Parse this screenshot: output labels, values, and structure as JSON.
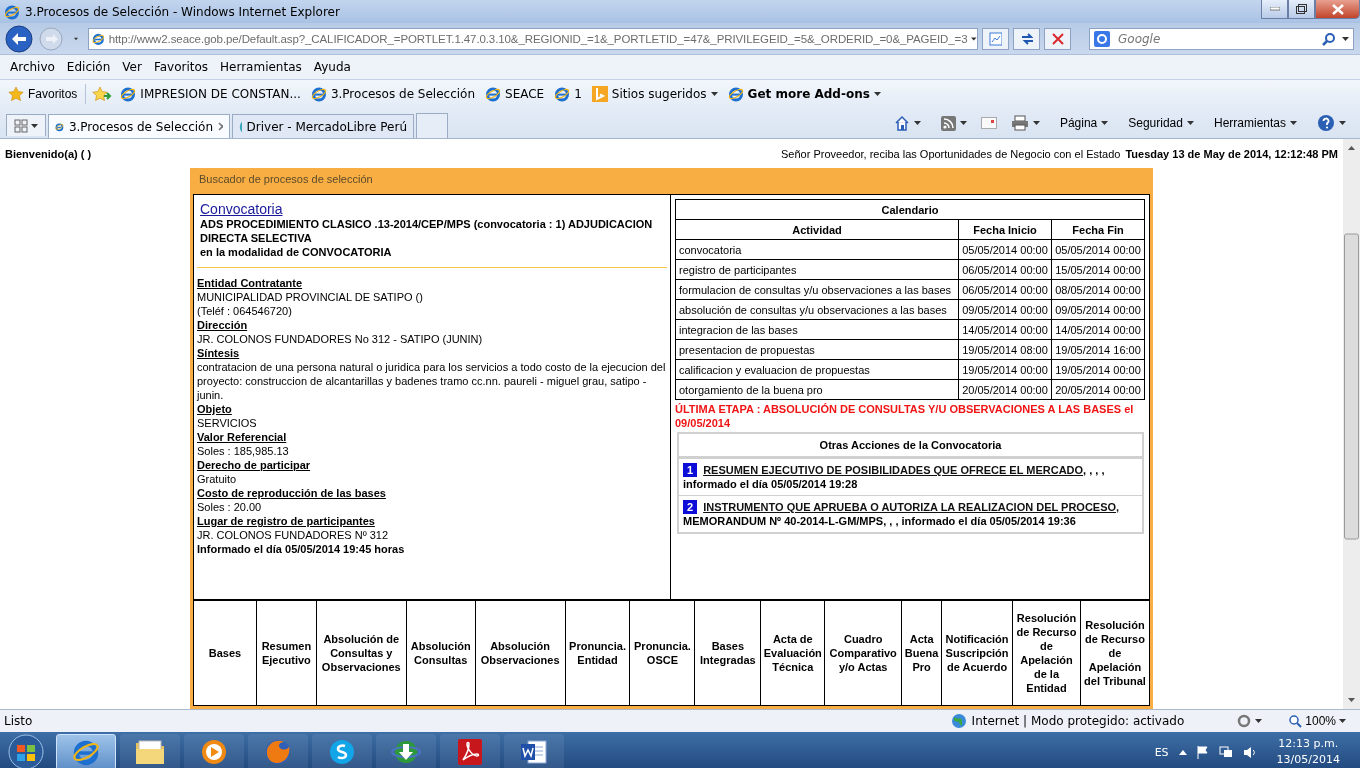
{
  "window": {
    "title": "3.Procesos de Selección - Windows Internet Explorer"
  },
  "address_bar": {
    "url": "http://www2.seace.gob.pe/Default.asp?_CALIFICADOR_=PORTLET.1.47.0.3.10&_REGIONID_=1&_PORTLETID_=47&_PRIVILEGEID_=5&_ORDERID_=0&_PAGEID_=3",
    "search_placeholder": "Google"
  },
  "menu": [
    "Archivo",
    "Edición",
    "Ver",
    "Favoritos",
    "Herramientas",
    "Ayuda"
  ],
  "favorites_bar": {
    "label": "Favoritos",
    "items": [
      {
        "label": "IMPRESION DE CONSTAN...",
        "kind": "page"
      },
      {
        "label": "3.Procesos de Selección",
        "kind": "page"
      },
      {
        "label": "SEACE",
        "kind": "page"
      },
      {
        "label": "1",
        "kind": "page"
      },
      {
        "label": "Sitios sugeridos",
        "kind": "suggested"
      },
      {
        "label": "Get more Add-ons",
        "kind": "addons"
      }
    ]
  },
  "tabs": [
    {
      "label": "3.Procesos de Selección",
      "selected": true
    },
    {
      "label": "Driver - MercadoLibre Perú",
      "selected": false
    }
  ],
  "command_bar": [
    "Página",
    "Seguridad",
    "Herramientas"
  ],
  "page": {
    "welcome": "Bienvenido(a) ( )",
    "slogan": "Señor Proveedor, reciba las Oportunidades de Negocio con el Estado",
    "date": "Tuesday 13 de May de 2014, 12:12:48 PM",
    "panel_title": "Buscador de procesos de selección",
    "convocatoria": {
      "link": "Convocatoria",
      "title": "ADS PROCEDIMIENTO CLASICO .13-2014/CEP/MPS (convocatoria : 1) ADJUDICACION DIRECTA SELECTIVA",
      "modality": "en la modalidad de CONVOCATORIA"
    },
    "fields": [
      {
        "label": "Entidad Contratante",
        "values": [
          "MUNICIPALIDAD PROVINCIAL DE SATIPO ()",
          "(Teléf : 064546720)"
        ]
      },
      {
        "label": "Dirección",
        "values": [
          "JR. COLONOS FUNDADORES No 312 - SATIPO (JUNIN)"
        ]
      },
      {
        "label": "Síntesis",
        "values": [
          "contratacion de una persona natural o juridica para los servicios a todo costo de la ejecucion del proyecto: construccion de alcantarillas y badenes tramo cc.nn. paureli - miguel grau, satipo - junin."
        ]
      },
      {
        "label": "Objeto",
        "values": [
          "SERVICIOS"
        ]
      },
      {
        "label": "Valor Referencial",
        "values": [
          "Soles : 185,985.13"
        ]
      },
      {
        "label": "Derecho de participar",
        "values": [
          "Gratuito"
        ]
      },
      {
        "label": "Costo de reproducción de las bases",
        "values": [
          "Soles : 20.00"
        ]
      },
      {
        "label": "Lugar de registro de participantes",
        "values": [
          "JR. COLONOS FUNDADORES Nº 312"
        ]
      }
    ],
    "informed": "Informado el día 05/05/2014 19:45 horas",
    "calendar": {
      "title": "Calendario",
      "columns": [
        "Actividad",
        "Fecha Inicio",
        "Fecha Fin"
      ],
      "rows": [
        [
          "convocatoria",
          "05/05/2014 00:00",
          "05/05/2014 00:00"
        ],
        [
          "registro de participantes",
          "06/05/2014 00:00",
          "15/05/2014 00:00"
        ],
        [
          "formulacion de consultas y/u observaciones a las bases",
          "06/05/2014 00:00",
          "08/05/2014 00:00"
        ],
        [
          "absolución de consultas y/u observaciones a las bases",
          "09/05/2014 00:00",
          "09/05/2014 00:00"
        ],
        [
          "integracion de las bases",
          "14/05/2014 00:00",
          "14/05/2014 00:00"
        ],
        [
          "presentacion de propuestas",
          "19/05/2014 08:00",
          "19/05/2014 16:00"
        ],
        [
          "calificacion y evaluacion de propuestas",
          "19/05/2014 00:00",
          "19/05/2014 00:00"
        ],
        [
          "otorgamiento de la buena pro",
          "20/05/2014 00:00",
          "20/05/2014 00:00"
        ]
      ]
    },
    "last_stage": "ÚLTIMA ETAPA : ABSOLUCIÓN DE CONSULTAS Y/U OBSERVACIONES A LAS BASES el 09/05/2014",
    "other_actions": {
      "title": "Otras Acciones de la Convocatoria",
      "items": [
        {
          "number": "1",
          "link": "RESUMEN EJECUTIVO DE POSIBILIDADES QUE OFRECE EL MERCADO",
          "rest": ", , , , informado el día 05/05/2014 19:28"
        },
        {
          "number": "2",
          "link": "INSTRUMENTO QUE APRUEBA O AUTORIZA LA REALIZACION DEL PROCESO,",
          "rest": " MEMORANDUM Nº 40-2014-L-GM/MPS, , , informado el día 05/05/2014 19:36"
        }
      ]
    },
    "documents_columns": [
      "Bases",
      "Resumen Ejecutivo",
      "Absolución de Consultas y Observaciones",
      "Absolución Consultas",
      "Absolución Observaciones",
      "Pronuncia. Entidad",
      "Pronuncia. OSCE",
      "Bases Integradas",
      "Acta de Evaluación Técnica",
      "Cuadro Comparativo y/o Actas",
      "Acta Buena Pro",
      "Notificación Suscripción de Acuerdo",
      "Resolución de Recurso de Apelación de la Entidad",
      "Resolución de Recurso de Apelación del Tribunal"
    ]
  },
  "status_bar": {
    "text": "Listo",
    "zone": "Internet | Modo protegido: activado",
    "zoom": "100%"
  },
  "taskbar": {
    "apps": [
      {
        "kind": "browser",
        "selected": true
      },
      {
        "kind": "folder",
        "selected": false
      },
      {
        "kind": "media",
        "selected": false
      },
      {
        "kind": "firefox",
        "selected": false
      },
      {
        "kind": "chat",
        "selected": false
      },
      {
        "kind": "download",
        "selected": false
      },
      {
        "kind": "pdf",
        "selected": false
      },
      {
        "kind": "word",
        "selected": false
      }
    ],
    "language": "ES",
    "time": "12:13 p.m.",
    "date": "13/05/2014"
  }
}
